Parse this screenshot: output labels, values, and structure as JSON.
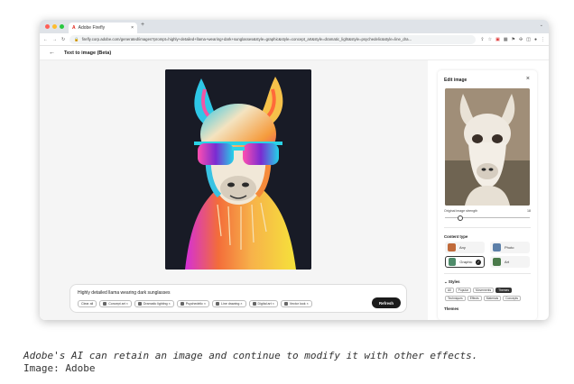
{
  "browser": {
    "tab_title": "Adobe Firefly",
    "tab_close": "×",
    "new_tab": "+",
    "url": "firefly.corp.adobe.com/generated/images?prompt=highly+detailed+llama+wearing+dark+sunglasses&style=graphic&style=concept_art&style=dramatic_light&style=psychedelic&style=line_dra...",
    "colors": {
      "close": "#ff5f57",
      "minimize": "#febc2e",
      "maximize": "#28c840"
    }
  },
  "app": {
    "back": "←",
    "title": "Text to image (Beta)"
  },
  "prompt": {
    "text": "Highly detailed llama wearing dark sunglasses",
    "chips": [
      "Clear all",
      "Concept art ×",
      "Dramatic lighting ×",
      "Psychedelic ×",
      "Line drawing ×",
      "Digital art ×",
      "Vector look ×"
    ],
    "refresh_label": "Refresh"
  },
  "side_panel": {
    "title": "Edit image",
    "close": "×",
    "strength_label": "Original image strength",
    "strength_value": "18",
    "content_type_label": "Content type",
    "content_types": [
      {
        "label": "Any",
        "selected": false
      },
      {
        "label": "Photo",
        "selected": false
      },
      {
        "label": "Graphic",
        "selected": true
      },
      {
        "label": "Art",
        "selected": false
      }
    ],
    "styles_label": "Styles",
    "style_tabs_row1": [
      "All",
      "Popular",
      "Movements",
      "Themes"
    ],
    "style_tabs_row2": [
      "Techniques",
      "Effects",
      "Materials",
      "Concepts"
    ],
    "themes_label": "Themes"
  },
  "caption": {
    "text": "Adobe's AI can retain an image and continue to modify it with other effects.",
    "credit": "Image: Adobe"
  }
}
